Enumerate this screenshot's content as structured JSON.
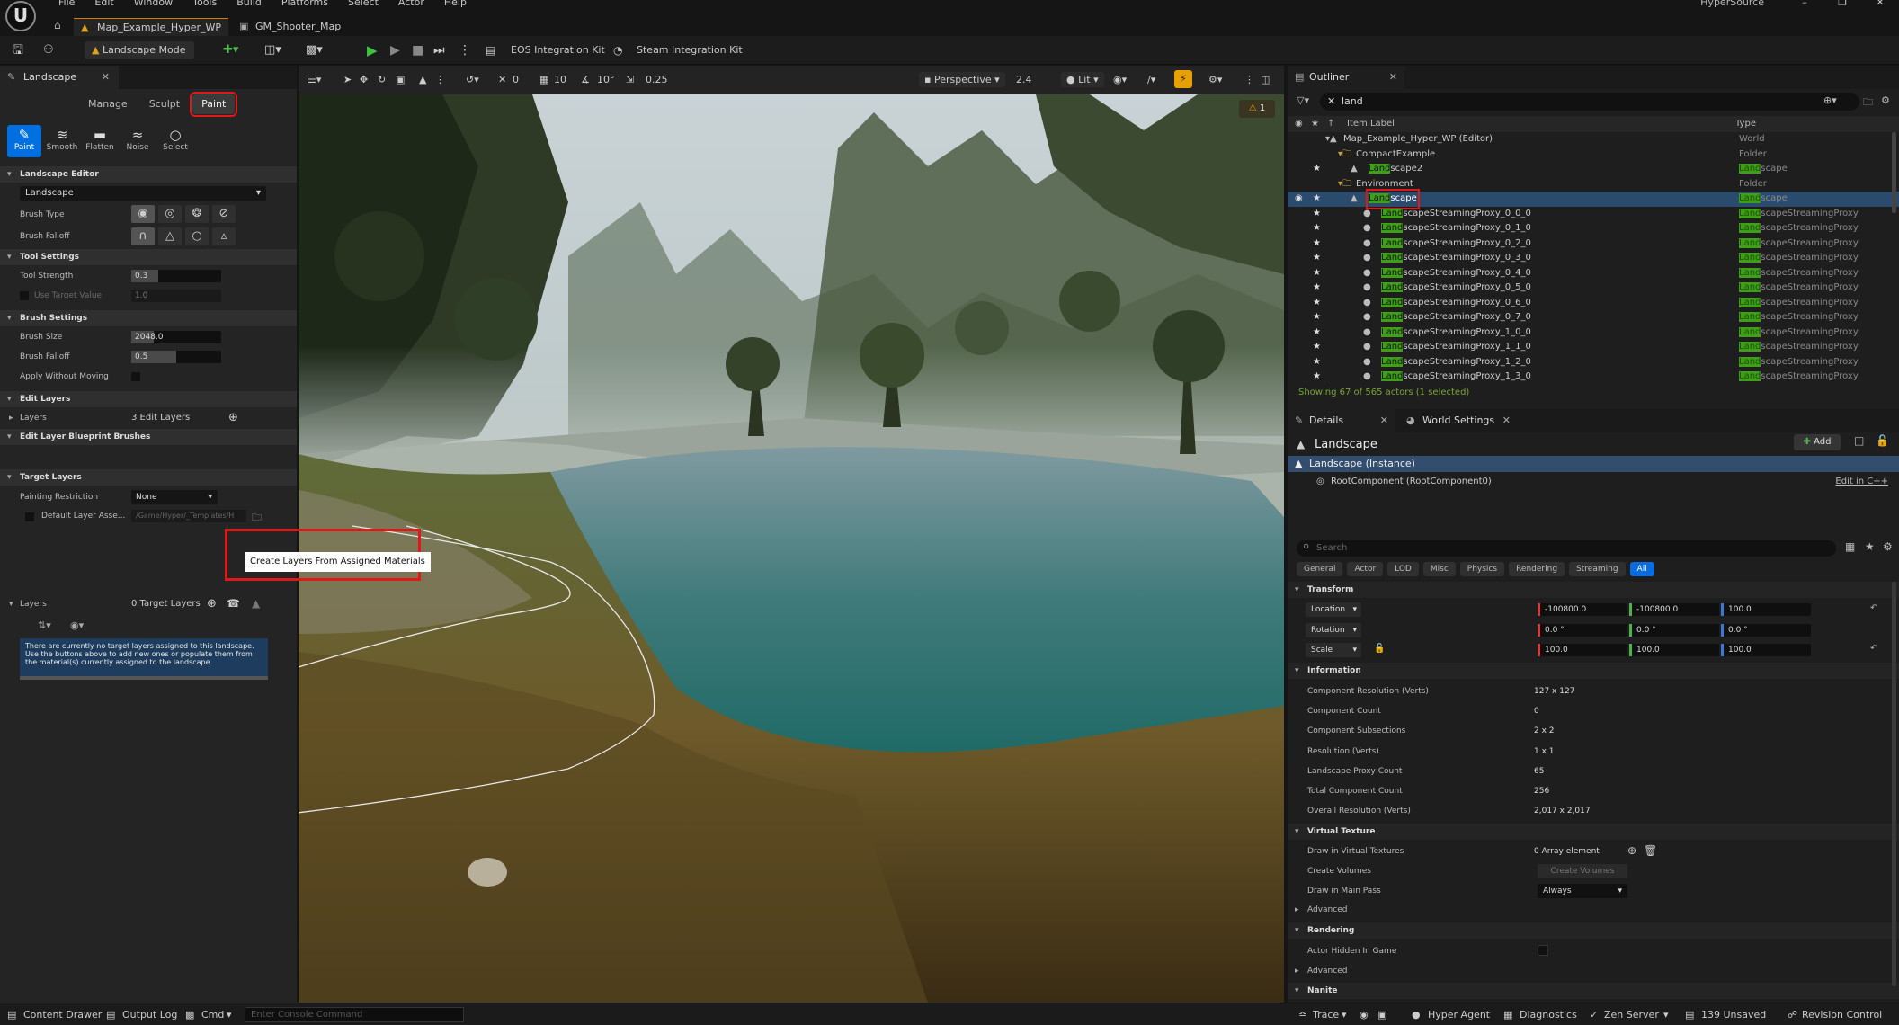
{
  "menu": [
    "File",
    "Edit",
    "Window",
    "Tools",
    "Build",
    "Platforms",
    "Select",
    "Actor",
    "Help"
  ],
  "app_title": "HyperSource",
  "doc_tabs": [
    "Map_Example_Hyper_WP",
    "GM_Shooter_Map"
  ],
  "toolbar": {
    "mode": "Landscape Mode",
    "eos": "EOS Integration Kit",
    "steam": "Steam Integration Kit"
  },
  "left": {
    "tab": "Landscape",
    "modes": [
      "Manage",
      "Sculpt",
      "Paint"
    ],
    "tools": [
      "Paint",
      "Smooth",
      "Flatten",
      "Noise",
      "Select"
    ],
    "sections": {
      "landscape_editor": "Landscape Editor",
      "tool_settings": "Tool Settings",
      "brush_settings": "Brush Settings",
      "edit_layers": "Edit Layers",
      "blueprint_brushes": "Edit Layer Blueprint Brushes",
      "target_layers": "Target Layers"
    },
    "landscape_select": "Landscape",
    "labels": {
      "brush_type": "Brush Type",
      "brush_falloff": "Brush Falloff",
      "tool_strength": "Tool Strength",
      "use_target_value": "Use Target Value",
      "brush_size": "Brush Size",
      "falloff": "Brush Falloff",
      "apply_without_moving": "Apply Without Moving",
      "layers": "Layers",
      "painting_restriction": "Painting Restriction",
      "default_layer_asset": "Default Layer Asse...",
      "target_layers": "Layers"
    },
    "values": {
      "tool_strength": "0.3",
      "tool_strength_level": 0.3,
      "use_target_value": "1.0",
      "brush_size": "2048.0",
      "brush_size_level": 0.25,
      "falloff": "0.5",
      "falloff_level": 0.5,
      "edit_layers": "3 Edit Layers",
      "painting_restriction": "None",
      "default_layer_asset": "/Game/Hyper/_Templates/H",
      "target_layers": "0 Target Layers"
    },
    "tooltip": "Create Layers From Assigned Materials",
    "notice": "There are currently no target layers assigned to this landscape. Use the buttons above to add new ones or populate them from the material(s) currently assigned to the landscape"
  },
  "viewport": {
    "perspective": "Perspective",
    "fov": "2.4",
    "lit": "Lit",
    "grid": "10",
    "angle": "10°",
    "scale": "0.25",
    "zero": "0",
    "warnings": "1"
  },
  "outliner": {
    "tab": "Outliner",
    "search": "land",
    "col_label": "Item Label",
    "col_type": "Type",
    "rows": [
      {
        "pre": "",
        "hl": "",
        "post": "Map_Example_Hyper_WP (Editor)",
        "type_hl": "",
        "type": "World",
        "indent": 1
      },
      {
        "pre": "",
        "hl": "",
        "post": "CompactExample",
        "type_hl": "",
        "type": "Folder",
        "indent": 2
      },
      {
        "pre": "",
        "hl": "Land",
        "post": "scape2",
        "type_hl": "Land",
        "type": "scape",
        "indent": 3
      },
      {
        "pre": "",
        "hl": "",
        "post": "Environment",
        "type_hl": "",
        "type": "Folder",
        "indent": 2
      },
      {
        "pre": "",
        "hl": "Land",
        "post": "scape",
        "type_hl": "Land",
        "type": "scape",
        "indent": 3,
        "selected": true
      },
      {
        "pre": "",
        "hl": "Land",
        "post": "scapeStreamingProxy_0_0_0",
        "type_hl": "Land",
        "type": "scapeStreamingProxy",
        "indent": 4
      },
      {
        "pre": "",
        "hl": "Land",
        "post": "scapeStreamingProxy_0_1_0",
        "type_hl": "Land",
        "type": "scapeStreamingProxy",
        "indent": 4
      },
      {
        "pre": "",
        "hl": "Land",
        "post": "scapeStreamingProxy_0_2_0",
        "type_hl": "Land",
        "type": "scapeStreamingProxy",
        "indent": 4
      },
      {
        "pre": "",
        "hl": "Land",
        "post": "scapeStreamingProxy_0_3_0",
        "type_hl": "Land",
        "type": "scapeStreamingProxy",
        "indent": 4
      },
      {
        "pre": "",
        "hl": "Land",
        "post": "scapeStreamingProxy_0_4_0",
        "type_hl": "Land",
        "type": "scapeStreamingProxy",
        "indent": 4
      },
      {
        "pre": "",
        "hl": "Land",
        "post": "scapeStreamingProxy_0_5_0",
        "type_hl": "Land",
        "type": "scapeStreamingProxy",
        "indent": 4
      },
      {
        "pre": "",
        "hl": "Land",
        "post": "scapeStreamingProxy_0_6_0",
        "type_hl": "Land",
        "type": "scapeStreamingProxy",
        "indent": 4
      },
      {
        "pre": "",
        "hl": "Land",
        "post": "scapeStreamingProxy_0_7_0",
        "type_hl": "Land",
        "type": "scapeStreamingProxy",
        "indent": 4
      },
      {
        "pre": "",
        "hl": "Land",
        "post": "scapeStreamingProxy_1_0_0",
        "type_hl": "Land",
        "type": "scapeStreamingProxy",
        "indent": 4
      },
      {
        "pre": "",
        "hl": "Land",
        "post": "scapeStreamingProxy_1_1_0",
        "type_hl": "Land",
        "type": "scapeStreamingProxy",
        "indent": 4
      },
      {
        "pre": "",
        "hl": "Land",
        "post": "scapeStreamingProxy_1_2_0",
        "type_hl": "Land",
        "type": "scapeStreamingProxy",
        "indent": 4
      },
      {
        "pre": "",
        "hl": "Land",
        "post": "scapeStreamingProxy_1_3_0",
        "type_hl": "Land",
        "type": "scapeStreamingProxy",
        "indent": 4
      }
    ],
    "status": "Showing 67 of 565 actors (1 selected)"
  },
  "details": {
    "tab": "Details",
    "tab2": "World Settings",
    "title": "Landscape",
    "add": "Add",
    "instance": "Landscape (Instance)",
    "root": "RootComponent (RootComponent0)",
    "edit_cpp": "Edit in C++",
    "search_placeholder": "Search",
    "cats": [
      "General",
      "Actor",
      "LOD",
      "Misc",
      "Physics",
      "Rendering",
      "Streaming",
      "All"
    ],
    "transform": "Transform",
    "location": "Location",
    "rotation": "Rotation",
    "scale": "Scale",
    "loc": [
      "-100800.0",
      "-100800.0",
      "100.0"
    ],
    "rot": [
      "0.0 °",
      "0.0 °",
      "0.0 °"
    ],
    "scl": [
      "100.0",
      "100.0",
      "100.0"
    ],
    "information": "Information",
    "info": [
      {
        "k": "Component Resolution (Verts)",
        "v": "127 x 127"
      },
      {
        "k": "Component Count",
        "v": "0"
      },
      {
        "k": "Component Subsections",
        "v": "2 x 2"
      },
      {
        "k": "Resolution (Verts)",
        "v": "1 x 1"
      },
      {
        "k": "Landscape Proxy Count",
        "v": "65"
      },
      {
        "k": "Total Component Count",
        "v": "256"
      },
      {
        "k": "Overall Resolution (Verts)",
        "v": "2,017 x 2,017"
      }
    ],
    "virtual_texture": "Virtual Texture",
    "draw_vt": "Draw in Virtual Textures",
    "draw_vt_val": "0 Array element",
    "create_volumes": "Create Volumes",
    "create_volumes_btn": "Create Volumes",
    "draw_main": "Draw in Main Pass",
    "draw_main_val": "Always",
    "advanced": "Advanced",
    "rendering": "Rendering",
    "actor_hidden": "Actor Hidden In Game",
    "advanced2": "Advanced",
    "nanite": "Nanite"
  },
  "status": {
    "content_drawer": "Content Drawer",
    "output_log": "Output Log",
    "cmd": "Cmd",
    "cmd_placeholder": "Enter Console Command",
    "trace": "Trace",
    "hyper_agent": "Hyper Agent",
    "diagnostics": "Diagnostics",
    "zen": "Zen Server",
    "unsaved": "139 Unsaved",
    "revision": "Revision Control"
  },
  "colors": {
    "accent": "#0070e0",
    "highlight_red": "#e01818",
    "search_match": "#3f9f18",
    "play_green": "#3ec33e"
  }
}
